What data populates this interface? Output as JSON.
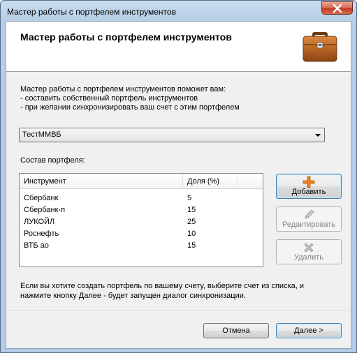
{
  "window": {
    "title": "Мастер работы с портфелем инструментов"
  },
  "header": {
    "title": "Мастер работы с портфелем инструментов"
  },
  "description": {
    "lines": [
      "Мастер работы с портфелем инструментов поможет вам:",
      "- составить собственный портфель инструментов",
      "- при желании синхронизировать ваш счет с этим портфелем"
    ]
  },
  "portfolio_select": {
    "value": "ТестММВБ"
  },
  "composition": {
    "label": "Состав портфеля:",
    "columns": [
      "Инструмент",
      "Доля (%)"
    ],
    "rows": [
      {
        "instrument": "Сбербанк",
        "share": "5"
      },
      {
        "instrument": "Сбербанк-п",
        "share": "15"
      },
      {
        "instrument": "ЛУКОЙЛ",
        "share": "25"
      },
      {
        "instrument": "Роснефть",
        "share": "10"
      },
      {
        "instrument": "ВТБ ао",
        "share": "15"
      }
    ]
  },
  "actions": {
    "add_label": "Добавить",
    "edit_label": "Редактировать",
    "delete_label": "Удалить"
  },
  "footnote": {
    "lines": [
      "Если вы хотите создать портфель по вашему счету, выберите счет из списка, и",
      "нажмите кнопку Далее - будет запущен диалог синхронизации."
    ]
  },
  "footer": {
    "cancel_label": "Отмена",
    "next_label": "Далее >"
  },
  "colors": {
    "accent": "#3c7fb1",
    "add_icon": "#e8821f",
    "disabled_text": "#838383"
  },
  "icons": {
    "briefcase": "briefcase-icon",
    "add": "plus-icon",
    "edit": "pencil-icon",
    "delete": "cross-icon",
    "close": "close-icon",
    "dropdown": "chevron-down-icon"
  }
}
